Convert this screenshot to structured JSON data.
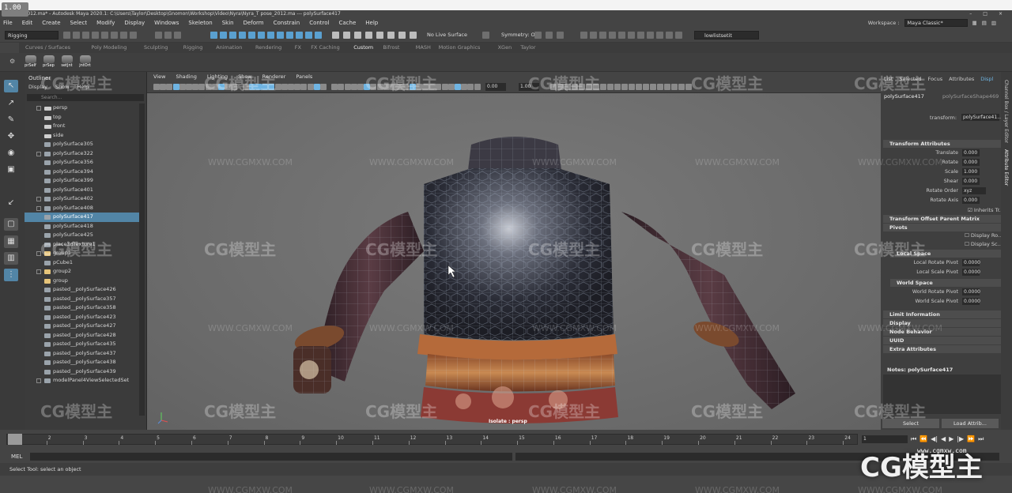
{
  "video_badge": "1.00",
  "title_bar": {
    "text": "...se_2012.ma* - Autodesk Maya 2020.1: C:\\Users\\Taylor\\Desktop\\Gnomon\\Workshop\\Video\\Nyra\\Nyra_T pose_2012.ma  ---  polySurface417",
    "controls": [
      "–",
      "□",
      "×"
    ]
  },
  "menu_bar": {
    "items": [
      "File",
      "Edit",
      "Create",
      "Select",
      "Modify",
      "Display",
      "Windows",
      "Skeleton",
      "Skin",
      "Deform",
      "Constrain",
      "Control",
      "Cache",
      "Help"
    ],
    "workspace_label": "Workspace :",
    "workspace_value": "Maya Classic*"
  },
  "status_line": {
    "menu_set": "Rigging",
    "live_surface": "No Live Surface",
    "symmetry": "Symmetry: Off",
    "selection_set": "lowlistsetit"
  },
  "shelf": {
    "tabs": [
      "Curves / Surfaces",
      "Poly Modeling",
      "Sculpting",
      "Rigging",
      "Animation",
      "Rendering",
      "FX",
      "FX Caching",
      "Custom",
      "Bifrost",
      "MASH",
      "Motion Graphics",
      "XGen",
      "Taylor"
    ],
    "active_tab": "Custom",
    "buttons": [
      "prSelf",
      "prSep",
      "setJnt",
      "jntOrt"
    ]
  },
  "toolbox": {
    "icons": [
      "select-arrow",
      "lasso",
      "paint-select",
      "move",
      "rotate",
      "scale",
      "last-tool",
      "layout-single",
      "layout-four",
      "layout-side",
      "layout-outliner"
    ]
  },
  "outliner": {
    "title": "Outliner",
    "menu": [
      "Display",
      "Show",
      "Help"
    ],
    "search_placeholder": "Search...",
    "items": [
      {
        "label": "persp",
        "icon": "cam",
        "expander": true
      },
      {
        "label": "top",
        "icon": "cam",
        "expander": false
      },
      {
        "label": "front",
        "icon": "cam",
        "expander": false
      },
      {
        "label": "side",
        "icon": "cam",
        "expander": false
      },
      {
        "label": "polySurface305",
        "icon": "mesh",
        "expander": false
      },
      {
        "label": "polySurface322",
        "icon": "mesh",
        "expander": true
      },
      {
        "label": "polySurface356",
        "icon": "mesh",
        "expander": false
      },
      {
        "label": "polySurface394",
        "icon": "mesh",
        "expander": false
      },
      {
        "label": "polySurface399",
        "icon": "mesh",
        "expander": false
      },
      {
        "label": "polySurface401",
        "icon": "mesh",
        "expander": false
      },
      {
        "label": "polySurface402",
        "icon": "mesh",
        "expander": true
      },
      {
        "label": "polySurface408",
        "icon": "mesh",
        "expander": true
      },
      {
        "label": "polySurface417",
        "icon": "mesh",
        "expander": false,
        "selected": true
      },
      {
        "label": "polySurface418",
        "icon": "mesh",
        "expander": false
      },
      {
        "label": "polySurface425",
        "icon": "mesh",
        "expander": false
      },
      {
        "label": "place3dTexture1",
        "icon": "mesh",
        "expander": false
      },
      {
        "label": "group1",
        "icon": "grp",
        "expander": true
      },
      {
        "label": "pCube1",
        "icon": "mesh",
        "expander": false
      },
      {
        "label": "group2",
        "icon": "grp",
        "expander": true
      },
      {
        "label": "group",
        "icon": "grp",
        "expander": false
      },
      {
        "label": "pasted__polySurface426",
        "icon": "mesh",
        "expander": false
      },
      {
        "label": "pasted__polySurface357",
        "icon": "mesh",
        "expander": false
      },
      {
        "label": "pasted__polySurface358",
        "icon": "mesh",
        "expander": false
      },
      {
        "label": "pasted__polySurface423",
        "icon": "mesh",
        "expander": false
      },
      {
        "label": "pasted__polySurface427",
        "icon": "mesh",
        "expander": false
      },
      {
        "label": "pasted__polySurface428",
        "icon": "mesh",
        "expander": false
      },
      {
        "label": "pasted__polySurface435",
        "icon": "mesh",
        "expander": false
      },
      {
        "label": "pasted__polySurface437",
        "icon": "mesh",
        "expander": false
      },
      {
        "label": "pasted__polySurface438",
        "icon": "mesh",
        "expander": false
      },
      {
        "label": "pasted__polySurface439",
        "icon": "mesh",
        "expander": false
      },
      {
        "label": "modelPanel4ViewSelectedSet",
        "icon": "mesh",
        "expander": true
      }
    ]
  },
  "viewport": {
    "menu": [
      "View",
      "Shading",
      "Lighting",
      "Show",
      "Renderer",
      "Panels"
    ],
    "field_a": "0.00",
    "field_b": "1.00",
    "isolate_label": "Isolate : persp"
  },
  "attribute_editor": {
    "tabs": [
      "List",
      "Selected",
      "Focus",
      "Attributes",
      "Displ"
    ],
    "node_name": "polySurface417",
    "shape_tab": "polySurfaceShape469",
    "transform_label": "transform:",
    "transform_value": "polySurface41...",
    "sections": {
      "transform_attributes": "Transform Attributes",
      "transform_offset": "Transform Offset Parent Matrix",
      "pivots": "Pivots",
      "local_space": "Local Space",
      "world_space": "World Space",
      "limit": "Limit Information",
      "display": "Display",
      "node_behavior": "Node Behavior",
      "uuid": "UUID",
      "extra": "Extra Attributes"
    },
    "transform_rows": [
      {
        "label": "Translate",
        "value": "0.000"
      },
      {
        "label": "Rotate",
        "value": "0.000"
      },
      {
        "label": "Scale",
        "value": "1.000"
      },
      {
        "label": "Shear",
        "value": "0.000"
      },
      {
        "label": "Rotate Order",
        "value": "xyz"
      },
      {
        "label": "Rotate Axis",
        "value": "0.000"
      }
    ],
    "inherits": "Inherits Tr...",
    "display_bo": "Display Ro...",
    "display_sc": "Display Sc...",
    "local_rows": [
      {
        "label": "Local Rotate Pivot",
        "value": "0.0000"
      },
      {
        "label": "Local Scale Pivot",
        "value": "0.0000"
      }
    ],
    "world_rows": [
      {
        "label": "World Rotate Pivot",
        "value": "0.0000"
      },
      {
        "label": "World Scale Pivot",
        "value": "0.0000"
      }
    ],
    "notes": "Notes: polySurface417",
    "buttons": {
      "select": "Select",
      "load": "Load Attrib..."
    }
  },
  "side_tabs": [
    "Channel Box / Layer Editor",
    "Attribute Editor"
  ],
  "time_slider": {
    "ticks": [
      "1",
      "2",
      "3",
      "4",
      "5",
      "6",
      "7",
      "8",
      "9",
      "10",
      "11",
      "12",
      "13",
      "14",
      "15",
      "16",
      "17",
      "18",
      "19",
      "20",
      "21",
      "22",
      "23",
      "24"
    ],
    "current_frame": "1",
    "frame_field": "1"
  },
  "command_line": {
    "label": "MEL"
  },
  "help_line": {
    "text": "Select Tool: select an object"
  },
  "watermark": {
    "text": "CG模型主",
    "url": "WWW.CGMXW.COM",
    "logo_url": "www.cgmxw.com"
  }
}
